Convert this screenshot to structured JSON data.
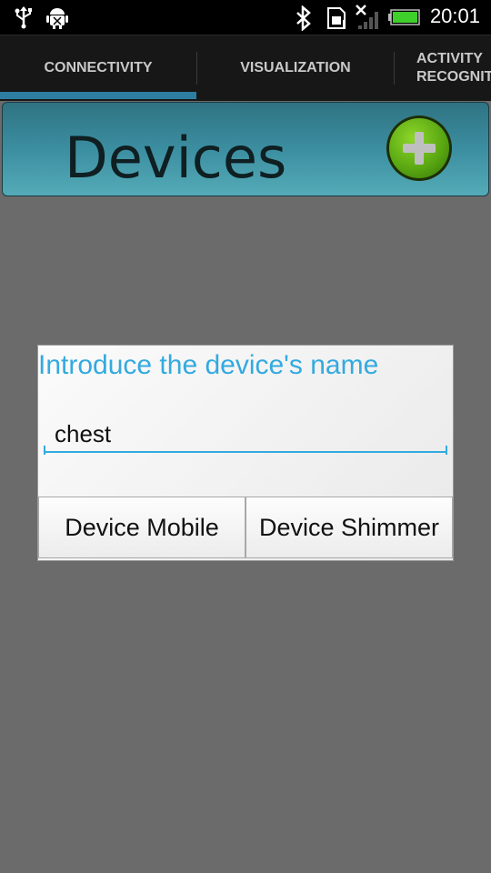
{
  "status_bar": {
    "time": "20:01",
    "icons": [
      "usb-icon",
      "android-debug-icon",
      "bluetooth-icon",
      "sim-icon",
      "signal-icon",
      "battery-icon"
    ]
  },
  "tabs": [
    {
      "label": "CONNECTIVITY",
      "selected": true
    },
    {
      "label": "VISUALIZATION",
      "selected": false
    },
    {
      "label_line1": "ACTIVITY",
      "label_line2": "RECOGNITI",
      "selected": false
    }
  ],
  "header": {
    "title": "Devices",
    "add_icon": "add-plus-icon"
  },
  "dialog": {
    "title": "Introduce the device's name",
    "input_value": "chest",
    "buttons": {
      "mobile": "Device Mobile",
      "shimmer": "Device Shimmer"
    }
  },
  "colors": {
    "accent": "#33aae0",
    "tab_indicator": "#2d7ea1",
    "header": "#3b8ea0",
    "add_button": "#57a511"
  }
}
